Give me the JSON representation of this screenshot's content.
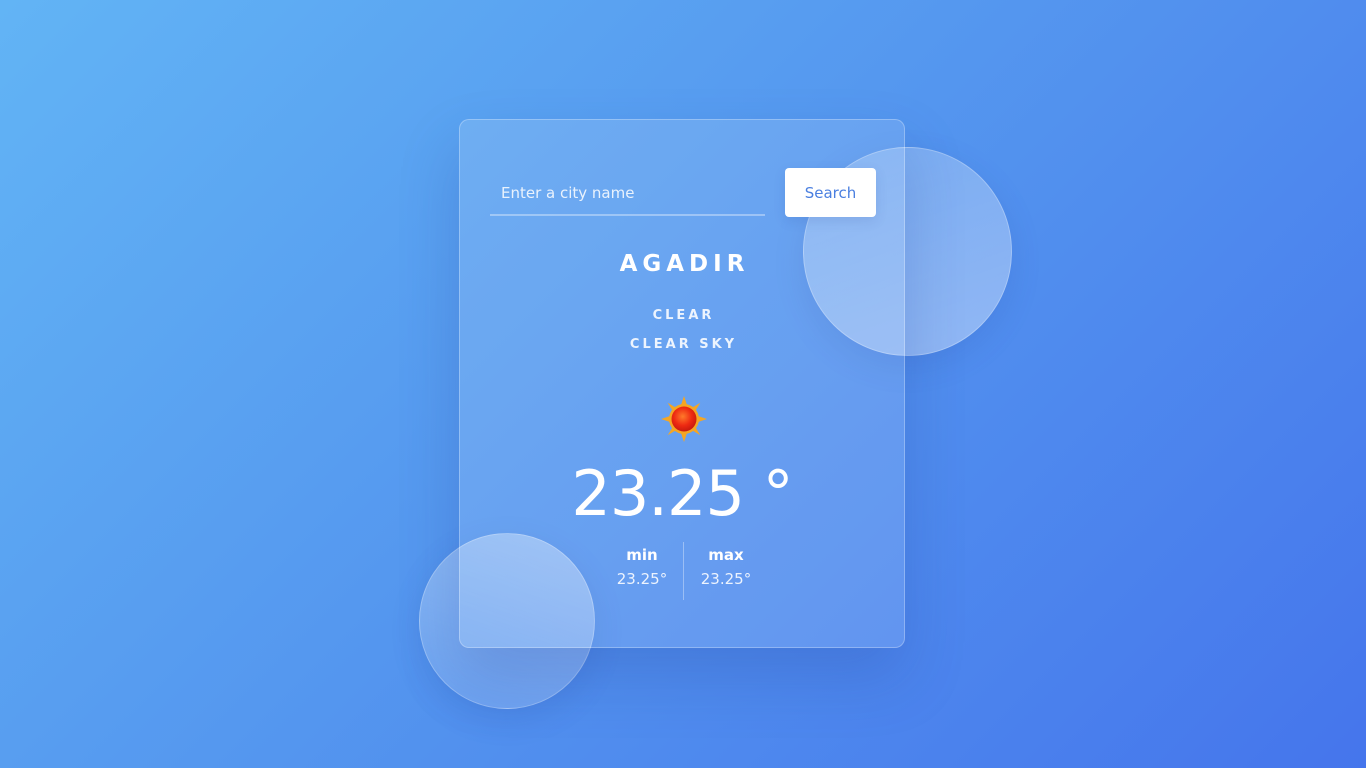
{
  "search": {
    "placeholder": "Enter a city name",
    "value": "",
    "button_label": "Search"
  },
  "weather": {
    "city": "AGADIR",
    "main": "CLEAR",
    "description": "CLEAR SKY",
    "icon": "sun-icon",
    "temperature": "23.25 °",
    "min_label": "min",
    "min_value": "23.25°",
    "max_label": "max",
    "max_value": "23.25°"
  },
  "colors": {
    "background_start": "#62b4f5",
    "background_end": "#4575ec",
    "button_text": "#4a7fe0",
    "sun_core": "#e8221b",
    "sun_rays": "#f5a623"
  }
}
